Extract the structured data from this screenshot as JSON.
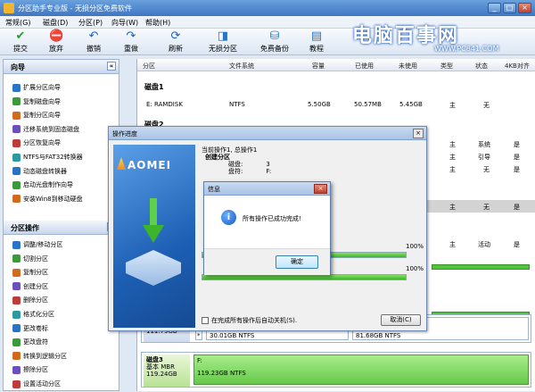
{
  "window": {
    "title": "分区助手专业版 - 无损分区免费软件",
    "controls": [
      "_",
      "□",
      "×"
    ]
  },
  "menu": [
    "常规(G)",
    "磁盘(D)",
    "分区(P)",
    "向导(W)",
    "帮助(H)"
  ],
  "toolbar": [
    {
      "label": "提交",
      "icon": "check-icon",
      "glyph": "✔",
      "color": "#2a9a2a"
    },
    {
      "label": "放弃",
      "icon": "discard-icon",
      "glyph": "⛔",
      "color": "#1f4fa0"
    },
    {
      "label": "撤销",
      "icon": "undo-icon",
      "glyph": "↶",
      "color": "#1f5fb8"
    },
    {
      "label": "重做",
      "icon": "redo-icon",
      "glyph": "↷",
      "color": "#1f5fb8"
    },
    {
      "label": "刷新",
      "icon": "refresh-icon",
      "glyph": "⟳",
      "color": "#1f5fb8"
    },
    {
      "label": "无损分区",
      "icon": "partition-icon",
      "glyph": "◨",
      "color": "#2a72c8"
    },
    {
      "label": "免费备份",
      "icon": "backup-icon",
      "glyph": "⛁",
      "color": "#2a72c8"
    },
    {
      "label": "教程",
      "icon": "tutorial-icon",
      "glyph": "▤",
      "color": "#2a72c8"
    }
  ],
  "watermark": {
    "brand": "电脑百事网",
    "url": "WWW.PC841.COM"
  },
  "left": {
    "wizard_title": "向导",
    "wizard_items": [
      "扩展分区向导",
      "复制磁盘向导",
      "复制分区向导",
      "迁移系统到固态磁盘",
      "分区恢复向导",
      "NTFS与FAT32转换器",
      "动态磁盘转换器",
      "启动光盘制作向导",
      "安装Win8到移动硬盘"
    ],
    "ops_title": "分区操作",
    "ops_items": [
      "调整/移动分区",
      "切割分区",
      "复制分区",
      "创建分区",
      "删除分区",
      "格式化分区",
      "更改卷标",
      "更改盘符",
      "转换到逻辑分区",
      "擦除分区",
      "设置活动分区"
    ]
  },
  "columns": [
    "分区",
    "文件系统",
    "容量",
    "已使用",
    "未使用",
    "类型",
    "状态",
    "4KB对齐"
  ],
  "disk1": {
    "label": "磁盘1",
    "row": {
      "name": "E: RAMDISK",
      "fs": "NTFS",
      "cap": "5.50GB",
      "used": "50.57MB",
      "free": "5.45GB",
      "type": "主",
      "status": "无"
    }
  },
  "disk2": {
    "label": "磁盘2"
  },
  "rows_right": [
    {
      "type": "主",
      "status": "系统",
      "align": "是"
    },
    {
      "type": "主",
      "status": "引导",
      "align": "是"
    },
    {
      "type": "主",
      "status": "无",
      "align": "是"
    },
    {
      "type": "主",
      "status": "无",
      "align": "是"
    },
    {
      "type": "主",
      "status": "活动",
      "align": "是"
    }
  ],
  "progress_dialog": {
    "title": "操作进度",
    "brand": "AOMEI",
    "current_op": "当前操作1, 总操作1",
    "op_name": "创建分区",
    "disk_label": "磁盘:",
    "disk_value": "3",
    "drive_label": "盘符:",
    "drive_value": "F:",
    "pct1": "100%",
    "pct2": "100%",
    "progress1": 1.0,
    "progress2": 1.0,
    "autooff": "在完成所有操作后自动关机(S).",
    "cancel": "取消(C)"
  },
  "message_box": {
    "title": "信息",
    "text": "所有操作已成功完成!",
    "ok": "确定",
    "icon": "info-icon"
  },
  "disk_cards": [
    {
      "name": "",
      "size": "111.79GB",
      "part_label": "*",
      "part": "30.01GB NTFS",
      "part2": "81.68GB NTFS"
    },
    {
      "name": "磁盘3",
      "type": "基本 MBR",
      "size": "119.24GB",
      "part_label": "F:",
      "part": "119.23GB NTFS"
    }
  ],
  "colors": {
    "accent": "#3f76c2",
    "green": "#66c94a",
    "highlight": "#d3d3d3"
  }
}
